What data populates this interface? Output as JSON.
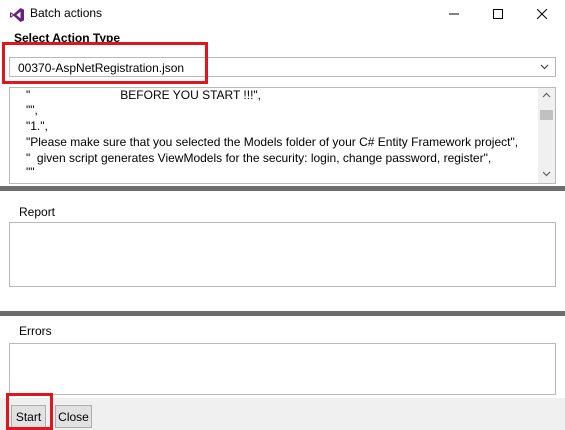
{
  "window": {
    "title": "Batch actions",
    "minimize_glyph": "—",
    "maximize_glyph": "☐",
    "close_glyph": "✕",
    "accent_color": "#68217a"
  },
  "action": {
    "section_label": "Select Action Type",
    "selected_value": "00370-AspNetRegistration.json",
    "chevron_glyph": "⌄"
  },
  "script": {
    "lines": [
      "\"                           BEFORE YOU START !!!\",",
      "\"\",",
      "\"1.\",",
      "\"Please make sure that you selected the Models folder of your C# Entity Framework project\",",
      "\"  given script generates ViewModels for the security: login, change password, register\",",
      "\"\""
    ]
  },
  "report": {
    "label": "Report"
  },
  "errors": {
    "label": "Errors"
  },
  "buttons": {
    "start_label": "Start",
    "close_label": "Close"
  },
  "highlight_color": "#e0161e"
}
